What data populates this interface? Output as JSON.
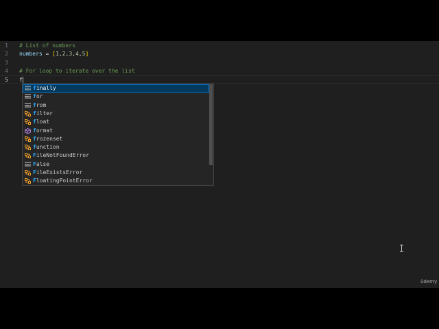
{
  "editor": {
    "lines": [
      {
        "number": "1",
        "tokens": [
          {
            "cls": "cm",
            "text": "# List of numbers"
          }
        ]
      },
      {
        "number": "2",
        "tokens": [
          {
            "cls": "var",
            "text": "numbers"
          },
          {
            "cls": "op",
            "text": " = "
          },
          {
            "cls": "br",
            "text": "["
          },
          {
            "cls": "num",
            "text": "1"
          },
          {
            "cls": "op",
            "text": ","
          },
          {
            "cls": "num",
            "text": "2"
          },
          {
            "cls": "op",
            "text": ","
          },
          {
            "cls": "num",
            "text": "3"
          },
          {
            "cls": "op",
            "text": ","
          },
          {
            "cls": "num",
            "text": "4"
          },
          {
            "cls": "op",
            "text": ","
          },
          {
            "cls": "num",
            "text": "5"
          },
          {
            "cls": "br",
            "text": "]"
          }
        ]
      },
      {
        "number": "3",
        "tokens": []
      },
      {
        "number": "4",
        "tokens": [
          {
            "cls": "cm",
            "text": "# For loop to iterate over the list"
          }
        ]
      },
      {
        "number": "5",
        "tokens": [
          {
            "cls": "op",
            "text": "f"
          }
        ],
        "current": true
      }
    ]
  },
  "suggestions": {
    "match_prefix": "f",
    "items": [
      {
        "label": "finally",
        "kind": "keyword",
        "selected": true
      },
      {
        "label": "for",
        "kind": "keyword"
      },
      {
        "label": "from",
        "kind": "keyword"
      },
      {
        "label": "filter",
        "kind": "class"
      },
      {
        "label": "float",
        "kind": "class"
      },
      {
        "label": "format",
        "kind": "function"
      },
      {
        "label": "frozenset",
        "kind": "class"
      },
      {
        "label": "function",
        "kind": "class"
      },
      {
        "label": "FileNotFoundError",
        "kind": "class"
      },
      {
        "label": "False",
        "kind": "keyword"
      },
      {
        "label": "FileExistsError",
        "kind": "class"
      },
      {
        "label": "FloatingPointError",
        "kind": "class"
      }
    ]
  },
  "watermark": "ûdemy",
  "colors": {
    "editor_bg": "#1f1f1f",
    "comment": "#6a9955",
    "variable": "#9cdcfe",
    "number": "#b5cea8",
    "bracket": "#ffd700",
    "match_highlight": "#2aaaff",
    "selection_bg": "#04395e",
    "class_icon": "#ee9d28",
    "function_icon": "#b180d7",
    "keyword_icon": "#cccccc"
  }
}
